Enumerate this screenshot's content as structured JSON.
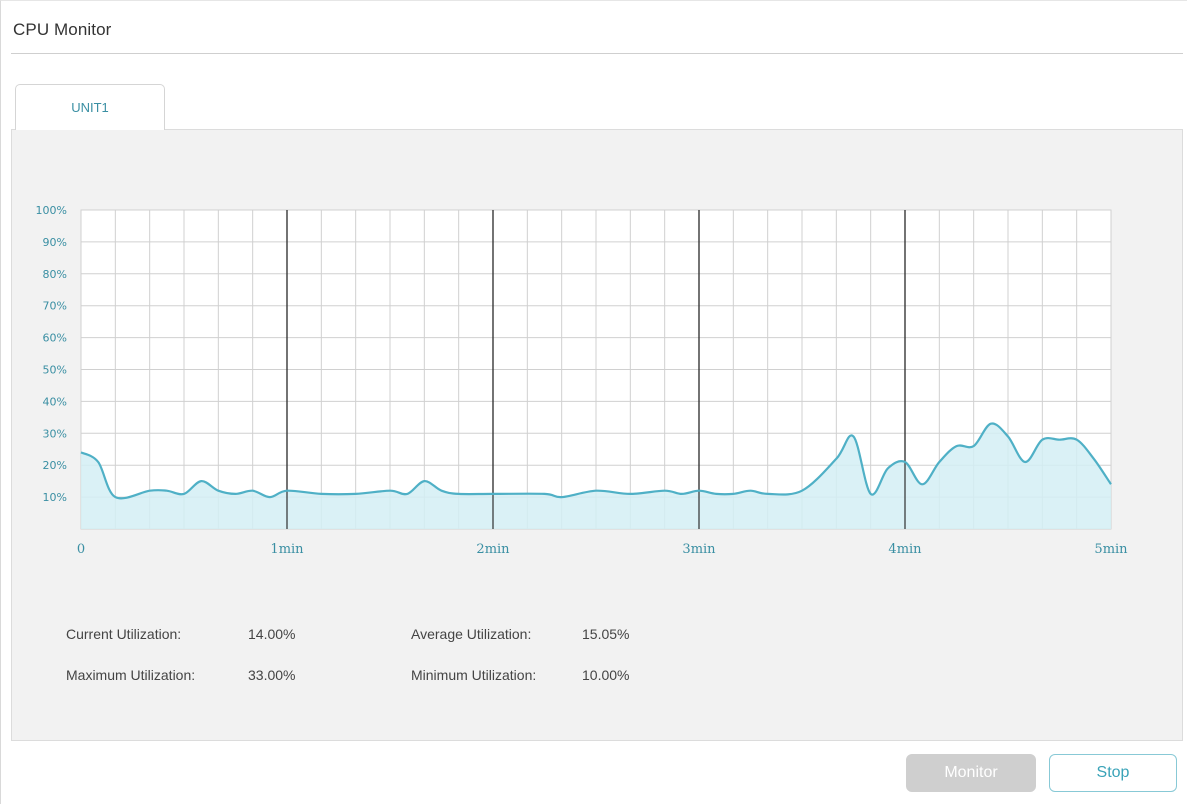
{
  "header": {
    "title": "CPU Monitor"
  },
  "tabs": [
    {
      "label": "UNIT1",
      "active": true
    }
  ],
  "chart_data": {
    "type": "area",
    "y_tick_labels": [
      "10%",
      "20%",
      "30%",
      "40%",
      "50%",
      "60%",
      "70%",
      "80%",
      "90%",
      "100%"
    ],
    "x_tick_labels": [
      "0",
      "1min",
      "2min",
      "3min",
      "4min",
      "5min"
    ],
    "ylim": [
      0,
      100
    ],
    "xlim": [
      0,
      300
    ],
    "grid": true,
    "series": [
      {
        "values_percent": [
          [
            0,
            24
          ],
          [
            5,
            21
          ],
          [
            10,
            10
          ],
          [
            20,
            12
          ],
          [
            25,
            12
          ],
          [
            30,
            11
          ],
          [
            35,
            15
          ],
          [
            40,
            12
          ],
          [
            45,
            11
          ],
          [
            50,
            12
          ],
          [
            55,
            10
          ],
          [
            60,
            12
          ],
          [
            70,
            11
          ],
          [
            80,
            11
          ],
          [
            90,
            12
          ],
          [
            95,
            11
          ],
          [
            100,
            15
          ],
          [
            105,
            12
          ],
          [
            110,
            11
          ],
          [
            120,
            11
          ],
          [
            135,
            11
          ],
          [
            140,
            10
          ],
          [
            150,
            12
          ],
          [
            160,
            11
          ],
          [
            170,
            12
          ],
          [
            175,
            11
          ],
          [
            180,
            12
          ],
          [
            185,
            11
          ],
          [
            190,
            11
          ],
          [
            195,
            12
          ],
          [
            200,
            11
          ],
          [
            210,
            12
          ],
          [
            220,
            22
          ],
          [
            225,
            29
          ],
          [
            230,
            11
          ],
          [
            235,
            19
          ],
          [
            240,
            21
          ],
          [
            245,
            14
          ],
          [
            250,
            21
          ],
          [
            255,
            26
          ],
          [
            260,
            26
          ],
          [
            265,
            33
          ],
          [
            270,
            29
          ],
          [
            275,
            21
          ],
          [
            280,
            28
          ],
          [
            285,
            28
          ],
          [
            290,
            28
          ],
          [
            295,
            22
          ],
          [
            300,
            14
          ]
        ]
      }
    ],
    "colors": {
      "line": "#4fb0c6",
      "fill": "#d4eff5",
      "major_grid": "#333333",
      "minor_grid": "#d0d0d0",
      "axis_label": "#3a8fa3"
    }
  },
  "stats": {
    "current_label": "Current Utilization:",
    "current_value": "14.00%",
    "average_label": "Average Utilization:",
    "average_value": "15.05%",
    "maximum_label": "Maximum Utilization:",
    "maximum_value": "33.00%",
    "minimum_label": "Minimum Utilization:",
    "minimum_value": "10.00%"
  },
  "buttons": {
    "monitor_label": "Monitor",
    "stop_label": "Stop"
  }
}
